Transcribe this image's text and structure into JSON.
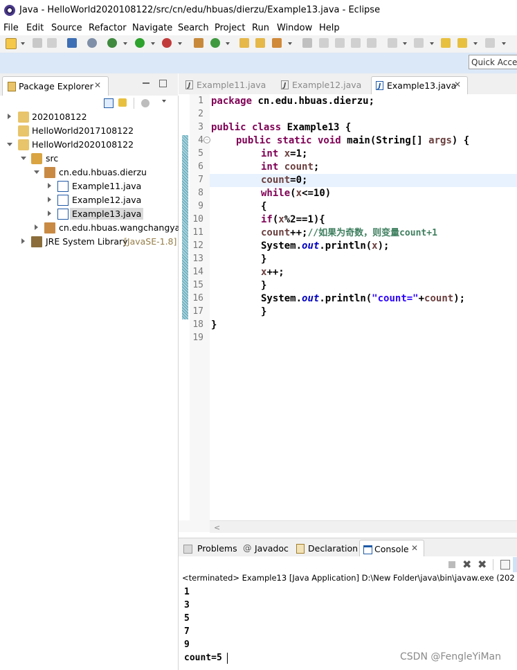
{
  "window": {
    "title": "Java - HelloWorld2020108122/src/cn/edu/hbuas/dierzu/Example13.java - Eclipse"
  },
  "menubar": {
    "items": [
      "File",
      "Edit",
      "Source",
      "Refactor",
      "Navigate",
      "Search",
      "Project",
      "Run",
      "Window",
      "Help"
    ]
  },
  "toolbar": {
    "quick_access": "Quick Access"
  },
  "package_explorer": {
    "tab_label": "Package Explorer",
    "tree": [
      {
        "label": "2020108122",
        "icon": "project-icon"
      },
      {
        "label": "HelloWorld2017108122",
        "icon": "project-icon"
      },
      {
        "label": "HelloWorld2020108122",
        "icon": "project-icon"
      },
      {
        "label": "src",
        "icon": "source-folder-icon"
      },
      {
        "label": "cn.edu.hbuas.dierzu",
        "icon": "package-icon"
      },
      {
        "label": "Example11.java",
        "icon": "java-file-icon"
      },
      {
        "label": "Example12.java",
        "icon": "java-file-icon"
      },
      {
        "label": "Example13.java",
        "icon": "java-file-icon"
      },
      {
        "label": "cn.edu.hbuas.wangchangyan",
        "icon": "package-icon"
      },
      {
        "label": "JRE System Library",
        "suffix": "[JavaSE-1.8]",
        "icon": "library-icon"
      }
    ]
  },
  "editor": {
    "tabs": [
      "Example11.java",
      "Example12.java",
      "Example13.java"
    ],
    "active_tab": "Example13.java",
    "line_numbers": [
      "1",
      "2",
      "3",
      "4",
      "5",
      "6",
      "7",
      "8",
      "9",
      "10",
      "11",
      "12",
      "13",
      "14",
      "15",
      "16",
      "17",
      "18",
      "19"
    ],
    "code": {
      "l1_kw": "package",
      "l1_rest": " cn.edu.hbuas.dierzu;",
      "l3_kw": "public class",
      "l3_rest": " Example13 {",
      "l4_kw": "public static void",
      "l4_rest": " main(String[] ",
      "l4_arg": "args",
      "l4_end": ") {",
      "l5_kw": "int",
      "l5_var": " x",
      "l5_rest": "=1;",
      "l6_kw": "int",
      "l6_var": " count",
      "l6_rest": ";",
      "l7_var": "count",
      "l7_rest": "=0;",
      "l8_kw": "while",
      "l8_a": "(",
      "l8_var": "x",
      "l8_rest": "<=10)",
      "l9": "{",
      "l10_kw": "if",
      "l10_a": "(",
      "l10_var": "x",
      "l10_rest": "%2==1){",
      "l11_var": "count",
      "l11_rest": "++;",
      "l11_cmt": "//如果为奇数，则变量count+1",
      "l12_a": "System.",
      "l12_out": "out",
      "l12_b": ".println(",
      "l12_var": "x",
      "l12_c": ");",
      "l13": "}",
      "l14_var": "x",
      "l14_rest": "++;",
      "l15": "}",
      "l16_a": "System.",
      "l16_out": "out",
      "l16_b": ".println(",
      "l16_str": "\"count=\"",
      "l16_c": "+",
      "l16_var": "count",
      "l16_d": ");",
      "l17": "}",
      "l18": "}"
    }
  },
  "bottom_panel": {
    "tabs": [
      "Problems",
      "Javadoc",
      "Declaration",
      "Console"
    ],
    "active_tab": "Console",
    "status": "<terminated> Example13 [Java Application] D:\\New Folder\\java\\bin\\javaw.exe (202",
    "output": [
      "1",
      "3",
      "5",
      "7",
      "9",
      "count=5"
    ]
  },
  "watermark": "CSDN @FengleYiMan"
}
